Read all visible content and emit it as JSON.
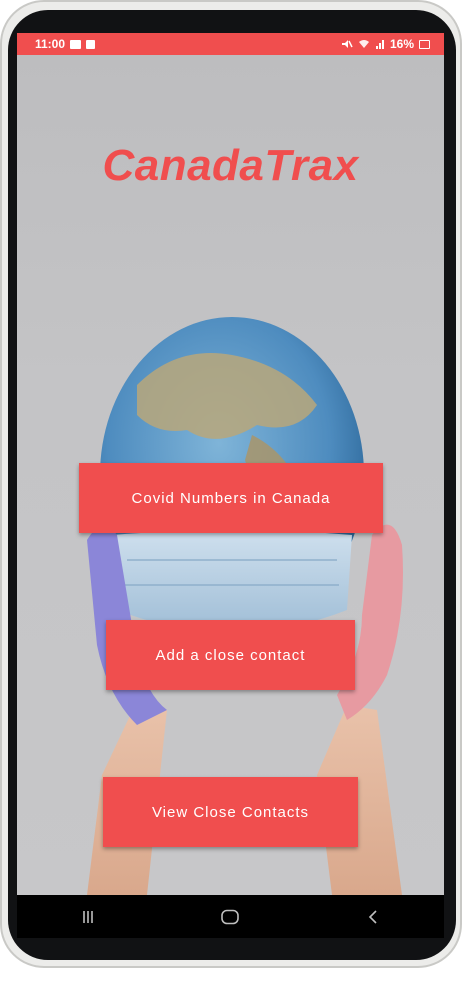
{
  "status_bar": {
    "time": "11:00",
    "battery": "16%"
  },
  "app": {
    "title": "CanadaTrax"
  },
  "buttons": {
    "covid_numbers": "Covid Numbers in Canada",
    "add_contact": "Add a close contact",
    "view_contacts": "View Close Contacts"
  },
  "colors": {
    "accent": "#f04e4e",
    "background": "#c4c4c6",
    "nav_bar": "#000000"
  },
  "icons": {
    "status_left": [
      "image-icon",
      "check-icon"
    ],
    "status_right": [
      "mute-icon",
      "wifi-icon",
      "signal-icon",
      "battery-icon"
    ],
    "navigation": [
      "recent-apps-icon",
      "home-icon",
      "back-icon"
    ]
  }
}
